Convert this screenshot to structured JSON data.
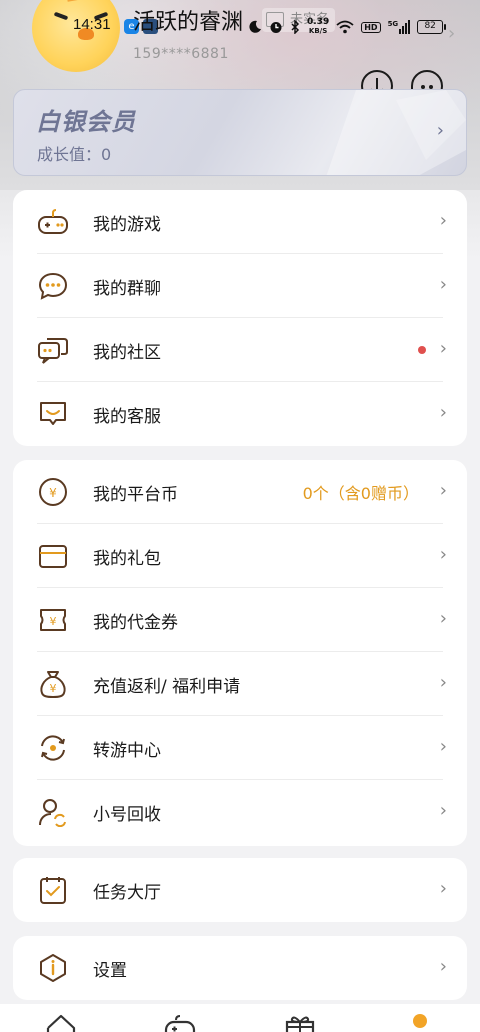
{
  "status_bar": {
    "time": "14:31",
    "network_speed_value": "0.39",
    "network_speed_unit": "KB/S",
    "hd_label": "HD",
    "signal_label": "5G",
    "battery": "82"
  },
  "profile": {
    "username": "活跃的睿渊",
    "verify_label": "未实名",
    "phone": "159****6881"
  },
  "vip": {
    "title": "白银会员",
    "growth": "成长值：0"
  },
  "menu_group_1": [
    {
      "label": "我的游戏",
      "icon": "gamepad-icon"
    },
    {
      "label": "我的群聊",
      "icon": "chat-bubble-icon"
    },
    {
      "label": "我的社区",
      "icon": "community-icon",
      "has_red_dot": true
    },
    {
      "label": "我的客服",
      "icon": "customer-service-icon"
    }
  ],
  "menu_group_2": [
    {
      "label": "我的平台币",
      "icon": "coin-icon",
      "extra": "0个（含0赠币）"
    },
    {
      "label": "我的礼包",
      "icon": "gift-box-icon"
    },
    {
      "label": "我的代金券",
      "icon": "voucher-icon"
    },
    {
      "label": "充值返利/ 福利申请",
      "icon": "money-bag-icon"
    },
    {
      "label": "转游中心",
      "icon": "transfer-icon"
    },
    {
      "label": "小号回收",
      "icon": "account-recycle-icon"
    }
  ],
  "menu_group_3": [
    {
      "label": "任务大厅",
      "icon": "task-checklist-icon"
    }
  ],
  "menu_group_4": [
    {
      "label": "设置",
      "icon": "settings-icon"
    }
  ],
  "bottom_nav": [
    {
      "icon": "home-icon"
    },
    {
      "icon": "games-icon"
    },
    {
      "icon": "gift-icon"
    },
    {
      "icon": "profile-icon",
      "active": true
    }
  ],
  "colors": {
    "accent": "#E29A1E",
    "icon_brown": "#5A3A22",
    "vip_text": "#6F7594",
    "red_dot": "#E0504E"
  }
}
